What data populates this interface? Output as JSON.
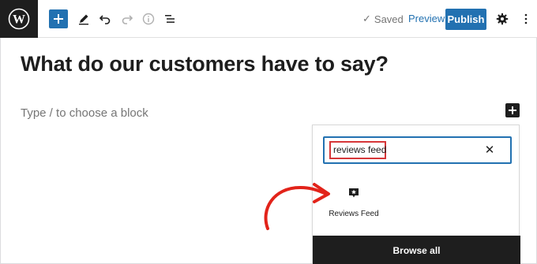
{
  "toolbar": {
    "logo_icon": "wordpress-icon",
    "add_block_icon": "plus-icon",
    "tools_icon": "pencil-icon",
    "undo_icon": "undo-icon",
    "redo_icon": "redo-icon",
    "details_icon": "info-icon",
    "list_view_icon": "list-view-icon",
    "saved_label": "Saved",
    "preview_label": "Preview",
    "publish_label": "Publish",
    "settings_icon": "gear-icon",
    "more_icon": "more-vertical-icon",
    "accent_color": "#2271b1"
  },
  "editor": {
    "title": "What do our customers have to say?",
    "block_placeholder": "Type / to choose a block"
  },
  "inserter": {
    "search_value": "reviews feed",
    "clear_icon": "close-icon",
    "results": [
      {
        "label": "Reviews Feed",
        "icon": "reviews-feed-icon"
      }
    ],
    "browse_all_label": "Browse all"
  },
  "annotation": {
    "arrow_color": "#e2231a",
    "highlight_color": "#d63638"
  }
}
